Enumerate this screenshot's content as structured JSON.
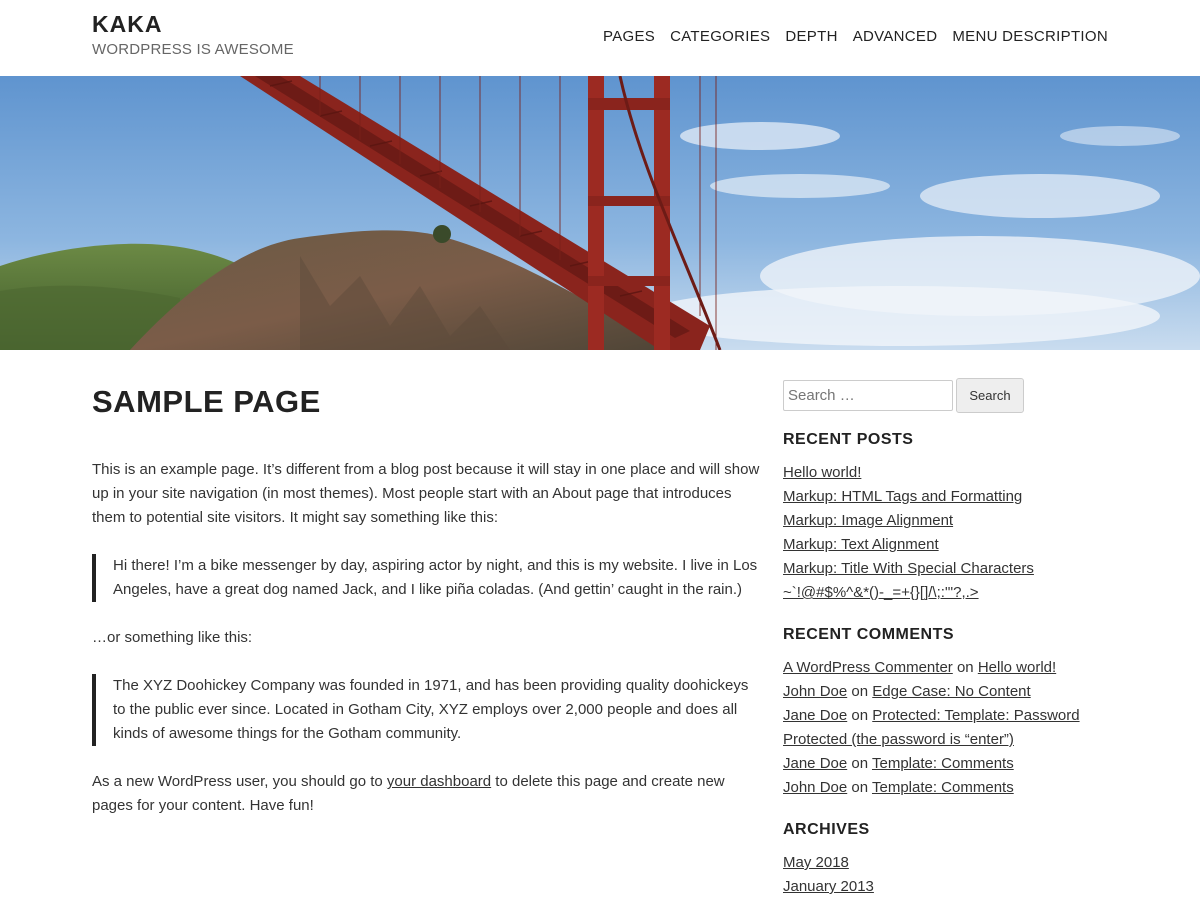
{
  "site": {
    "title": "KAKA",
    "tagline": "WORDPRESS IS AWESOME"
  },
  "nav": {
    "items": [
      {
        "label": "PAGES"
      },
      {
        "label": "CATEGORIES"
      },
      {
        "label": "DEPTH"
      },
      {
        "label": "ADVANCED"
      },
      {
        "label": "MENU DESCRIPTION"
      }
    ]
  },
  "hero": {
    "subject": "golden-gate-bridge-photo",
    "colors": {
      "sky": "#7ea9d8",
      "bridge": "#9c2a22",
      "hill": "#5b6b3a"
    }
  },
  "page": {
    "title": "SAMPLE PAGE",
    "intro": "This is an example page. It’s different from a blog post because it will stay in one place and will show up in your site navigation (in most themes). Most people start with an About page that introduces them to potential site visitors. It might say something like this:",
    "quote1": "Hi there! I’m a bike messenger by day, aspiring actor by night, and this is my website. I live in Los Angeles, have a great dog named Jack, and I like piña coladas. (And gettin’ caught in the rain.)",
    "middle": "…or something like this:",
    "quote2": "The XYZ Doohickey Company was founded in 1971, and has been providing quality doohickeys to the public ever since. Located in Gotham City, XYZ employs over 2,000 people and does all kinds of awesome things for the Gotham community.",
    "outro_before": "As a new WordPress user, you should go to ",
    "outro_link": "your dashboard",
    "outro_after": " to delete this page and create new pages for your content. Have fun!"
  },
  "sidebar": {
    "search": {
      "placeholder": "Search …",
      "button": "Search"
    },
    "recent_posts": {
      "title": "RECENT POSTS",
      "items": [
        {
          "label": "Hello world!"
        },
        {
          "label": "Markup: HTML Tags and Formatting"
        },
        {
          "label": "Markup: Image Alignment"
        },
        {
          "label": "Markup: Text Alignment"
        },
        {
          "label": "Markup: Title With Special Characters ~`!@#$%^&*()-_=+{}[]/\\;:'\"?,.>"
        }
      ]
    },
    "recent_comments": {
      "title": "RECENT COMMENTS",
      "connector": "on",
      "items": [
        {
          "author": "A WordPress Commenter",
          "post": "Hello world!"
        },
        {
          "author": "John Doe",
          "post": "Edge Case: No Content"
        },
        {
          "author": "Jane Doe",
          "post": "Protected: Template: Password Protected (the password is “enter”)"
        },
        {
          "author": "Jane Doe",
          "post": "Template: Comments"
        },
        {
          "author": "John Doe",
          "post": "Template: Comments"
        }
      ]
    },
    "archives": {
      "title": "ARCHIVES",
      "items": [
        {
          "label": "May 2018"
        },
        {
          "label": "January 2013"
        }
      ]
    }
  }
}
